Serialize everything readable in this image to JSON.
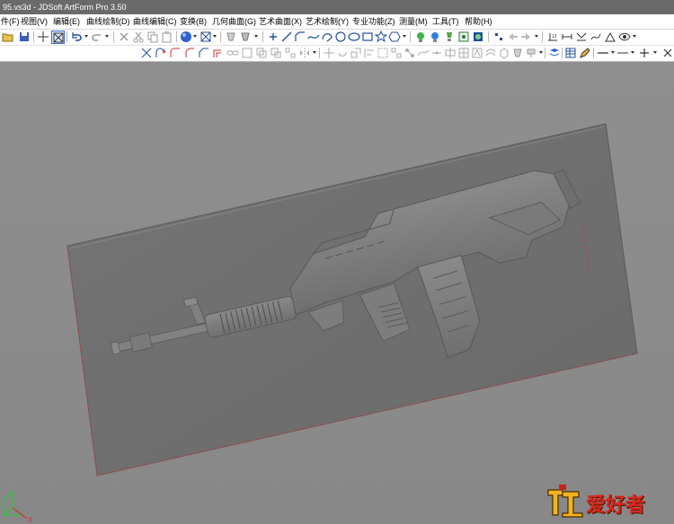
{
  "window": {
    "title": "95.vs3d - JDSoft ArtForm Pro 3.50"
  },
  "menu": [
    {
      "label": "件(F)"
    },
    {
      "label": "视图(V)"
    },
    {
      "label": "编辑(E)"
    },
    {
      "label": "曲线绘制(D)"
    },
    {
      "label": "曲线编辑(C)"
    },
    {
      "label": "变换(B)"
    },
    {
      "label": "几何曲面(G)"
    },
    {
      "label": "艺术曲面(X)"
    },
    {
      "label": "艺术绘制(Y)"
    },
    {
      "label": "专业功能(Z)"
    },
    {
      "label": "测量(M)"
    },
    {
      "label": "工具(T)"
    },
    {
      "label": "帮助(H)"
    }
  ],
  "viewport": {
    "axis": {
      "x_label": "X"
    }
  },
  "logo": {
    "text": "爱好者",
    "icon": "carpenter-logo-icon"
  },
  "colors": {
    "viewport_bg": "#8c8c8c",
    "relief": "#6f6f6f",
    "titlebar": "#6a6a6a",
    "red_axis": "#d23030"
  }
}
